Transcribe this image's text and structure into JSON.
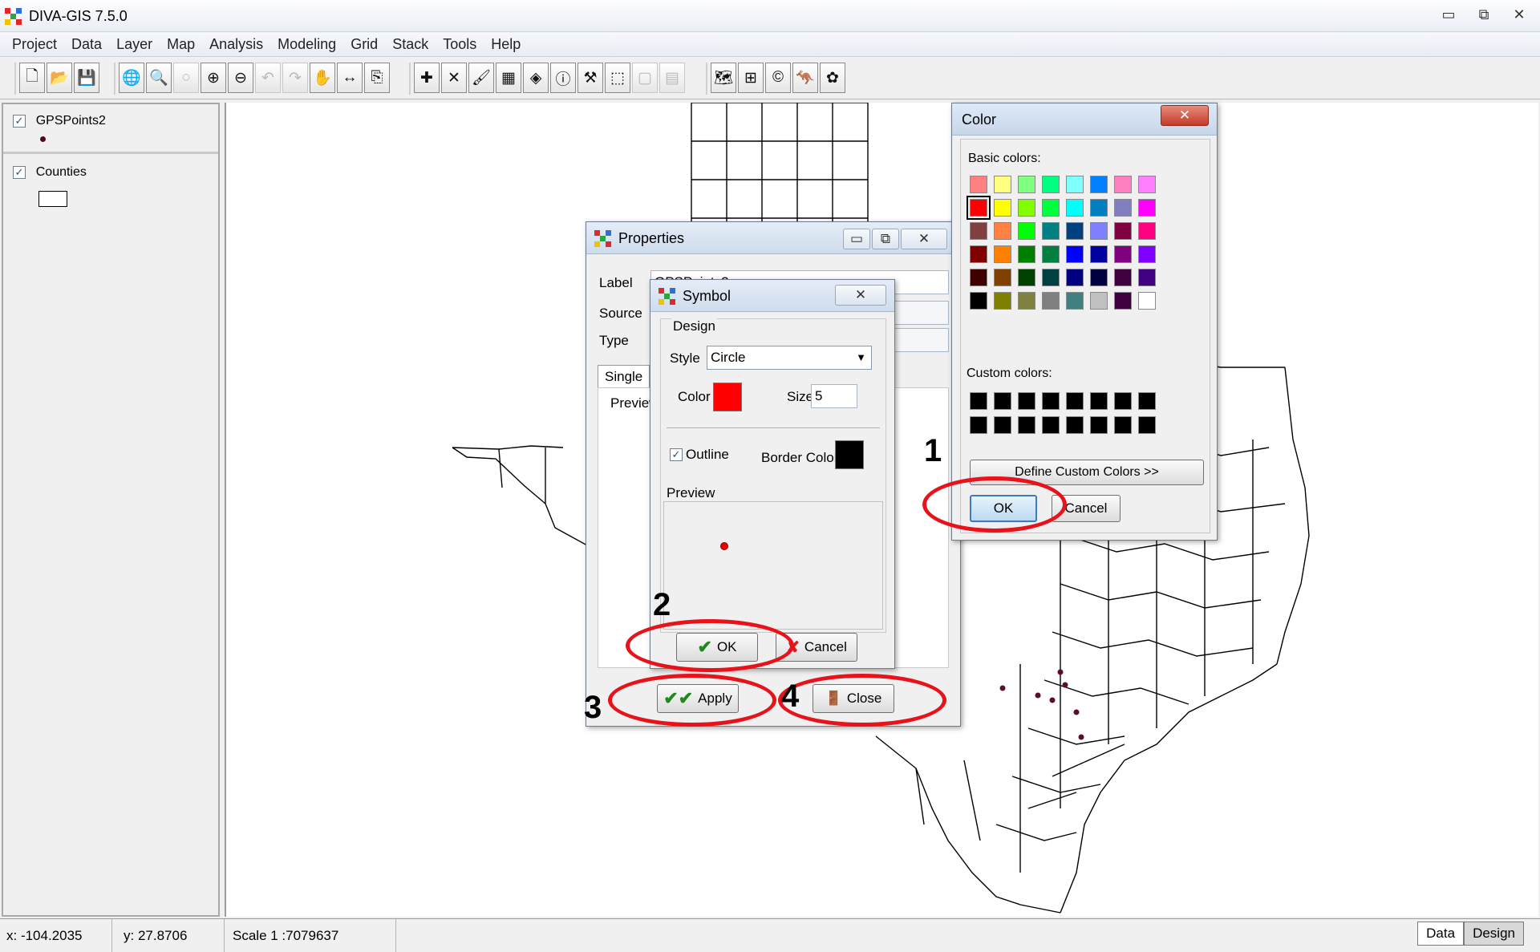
{
  "window": {
    "title": "DIVA-GIS 7.5.0",
    "min": "▭",
    "restore": "⧉",
    "close": "✕"
  },
  "menu": [
    "Project",
    "Data",
    "Layer",
    "Map",
    "Analysis",
    "Modeling",
    "Grid",
    "Stack",
    "Tools",
    "Help"
  ],
  "layers": [
    {
      "name": "GPSPoints2",
      "checked": "✓"
    },
    {
      "name": "Counties",
      "checked": "✓"
    }
  ],
  "status": {
    "x": "x: -104.2035",
    "y": "y: 27.8706",
    "scale": "Scale 1 :7079637",
    "tab_data": "Data",
    "tab_design": "Design"
  },
  "properties": {
    "title": "Properties",
    "label_lbl": "Label",
    "label_value": "GPSPoints2",
    "source_lbl": "Source",
    "type_lbl": "Type",
    "tab_single": "Single",
    "preview_lbl": "Preview",
    "apply": "Apply",
    "close": "Close"
  },
  "symbol": {
    "title": "Symbol",
    "design": "Design",
    "style_lbl": "Style",
    "style_value": "Circle",
    "color_lbl": "Color",
    "size_lbl": "Size",
    "size_value": "5",
    "outline_lbl": "Outline",
    "outline_checked": "✓",
    "border_color_lbl": "Border Color",
    "preview_lbl": "Preview",
    "ok": "OK",
    "cancel": "Cancel",
    "fill_color": "#ff0000",
    "border_color": "#000000"
  },
  "color_dialog": {
    "title": "Color",
    "basic_lbl": "Basic colors:",
    "custom_lbl": "Custom colors:",
    "define_custom": "Define Custom Colors >>",
    "ok": "OK",
    "cancel": "Cancel",
    "basic_colors": [
      [
        "#ff8080",
        "#ffff80",
        "#80ff80",
        "#00ff80",
        "#80ffff",
        "#0080ff",
        "#ff80c0",
        "#ff80ff"
      ],
      [
        "#ff0000",
        "#ffff00",
        "#80ff00",
        "#00ff40",
        "#00ffff",
        "#0080c0",
        "#8080c0",
        "#ff00ff"
      ],
      [
        "#804040",
        "#ff8040",
        "#00ff00",
        "#008080",
        "#004080",
        "#8080ff",
        "#800040",
        "#ff0080"
      ],
      [
        "#800000",
        "#ff8000",
        "#008000",
        "#008040",
        "#0000ff",
        "#0000a0",
        "#800080",
        "#8000ff"
      ],
      [
        "#400000",
        "#804000",
        "#004000",
        "#004040",
        "#000080",
        "#000040",
        "#400040",
        "#400080"
      ],
      [
        "#000000",
        "#808000",
        "#808040",
        "#808080",
        "#408080",
        "#c0c0c0",
        "#400040",
        "#ffffff"
      ]
    ],
    "selected": "#ff0000"
  },
  "annotations": [
    "1",
    "2",
    "3",
    "4"
  ]
}
